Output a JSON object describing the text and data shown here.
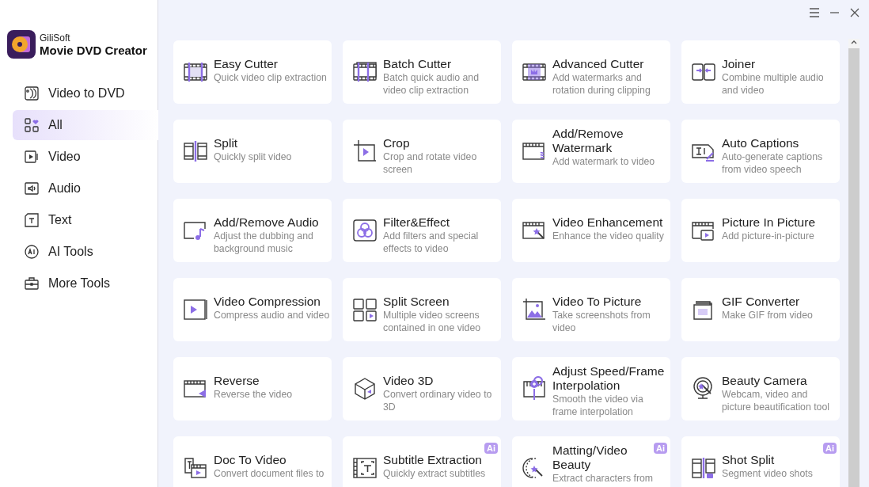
{
  "app": {
    "brand": "GiliSoft",
    "product": "Movie DVD Creator"
  },
  "sidebar": {
    "items": [
      {
        "label": "Video to DVD",
        "selected": false
      },
      {
        "label": "All",
        "selected": true
      },
      {
        "label": "Video",
        "selected": false
      },
      {
        "label": "Audio",
        "selected": false
      },
      {
        "label": "Text",
        "selected": false
      },
      {
        "label": "AI Tools",
        "selected": false
      },
      {
        "label": "More Tools",
        "selected": false
      }
    ]
  },
  "tools": [
    {
      "title": "Easy Cutter",
      "description": "Quick video clip extraction"
    },
    {
      "title": "Batch Cutter",
      "description": "Batch quick audio and video clip extraction"
    },
    {
      "title": "Advanced Cutter",
      "description": "Add watermarks and rotation during clipping"
    },
    {
      "title": "Joiner",
      "description": "Combine multiple audio and video"
    },
    {
      "title": "Split",
      "description": "Quickly split video"
    },
    {
      "title": "Crop",
      "description": "Crop and rotate video screen"
    },
    {
      "title": "Add/Remove Watermark",
      "description": "Add watermark to video"
    },
    {
      "title": "Auto Captions",
      "description": "Auto-generate captions from video speech"
    },
    {
      "title": "Add/Remove Audio",
      "description": "Adjust the dubbing and background music"
    },
    {
      "title": "Filter&Effect",
      "description": "Add filters and special effects to video"
    },
    {
      "title": "Video Enhancement",
      "description": "Enhance the video quality"
    },
    {
      "title": "Picture In Picture",
      "description": "Add picture-in-picture"
    },
    {
      "title": "Video Compression",
      "description": "Compress audio and video"
    },
    {
      "title": "Split Screen",
      "description": "Multiple video screens contained in one video"
    },
    {
      "title": "Video To Picture",
      "description": "Take screenshots from video"
    },
    {
      "title": "GIF Converter",
      "description": "Make GIF from video"
    },
    {
      "title": "Reverse",
      "description": "Reverse the video"
    },
    {
      "title": "Video 3D",
      "description": "Convert ordinary video to 3D"
    },
    {
      "title": "Adjust Speed/Frame Interpolation",
      "description": "Smooth the video via frame interpolation"
    },
    {
      "title": "Beauty Camera",
      "description": "Webcam, video and picture beautification tool"
    },
    {
      "title": "Doc To Video",
      "description": "Convert document files to"
    },
    {
      "title": "Subtitle Extraction",
      "description": "Quickly extract subtitles",
      "badge": "Ai"
    },
    {
      "title": "Matting/Video Beauty",
      "description": "Extract characters from",
      "badge": "Ai"
    },
    {
      "title": "Shot Split",
      "description": "Segment video shots",
      "badge": "Ai"
    }
  ]
}
